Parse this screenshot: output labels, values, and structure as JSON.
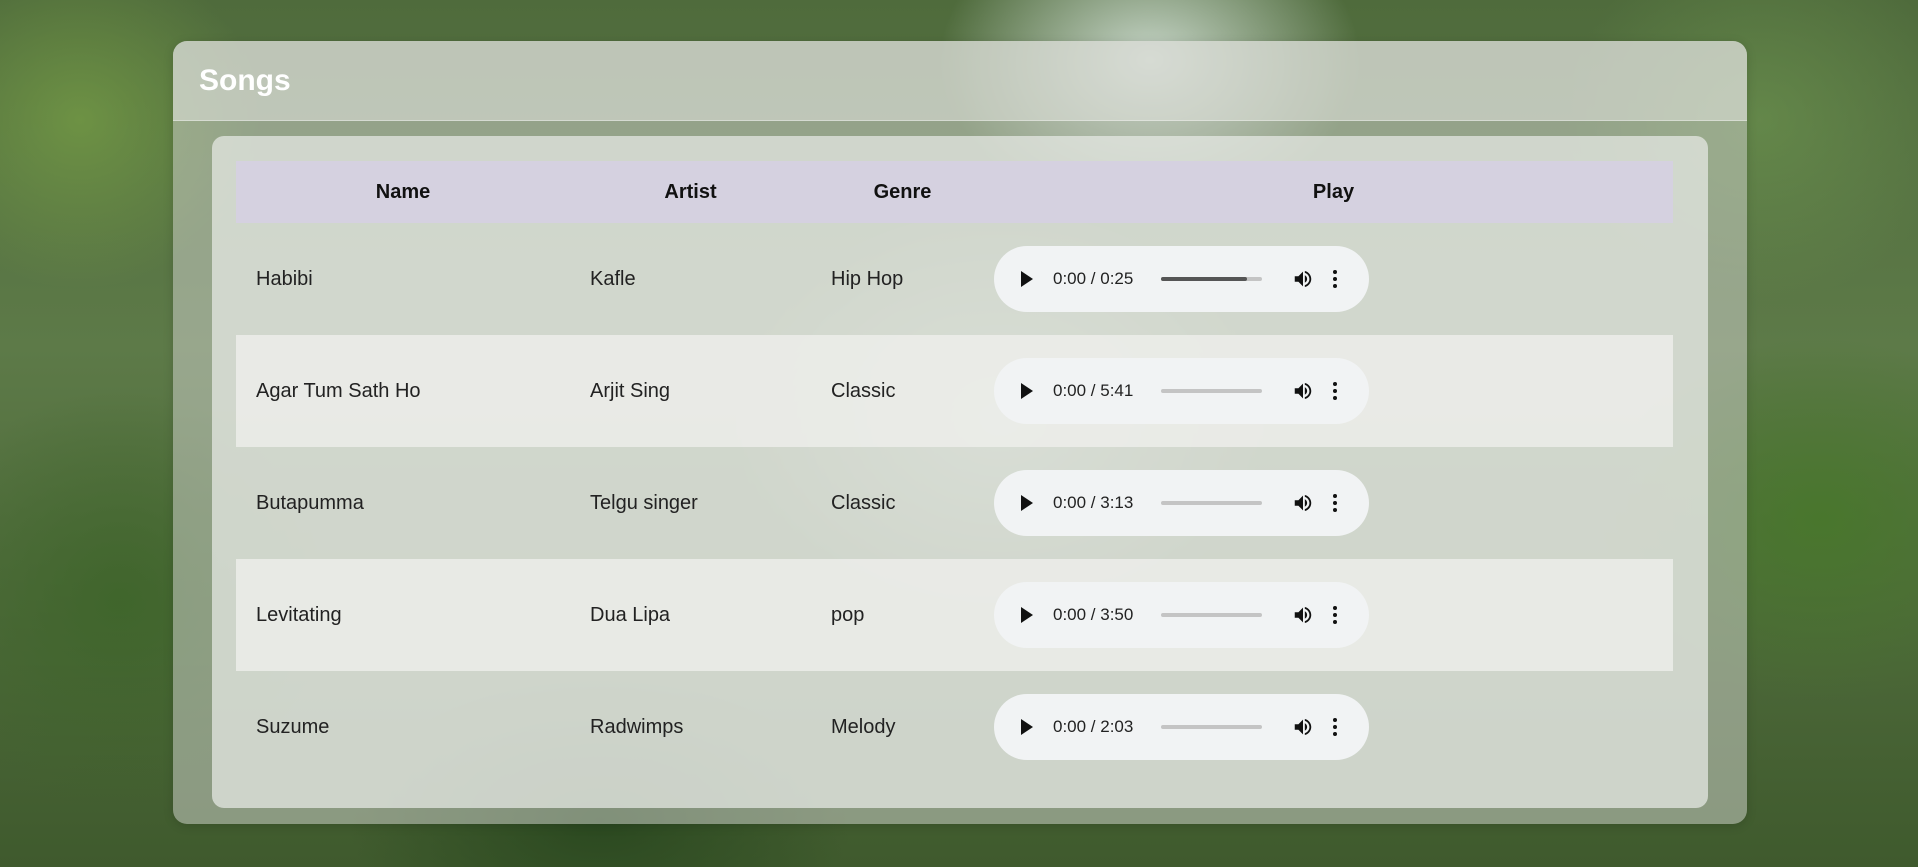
{
  "page": {
    "title": "Songs"
  },
  "table": {
    "headers": {
      "name": "Name",
      "artist": "Artist",
      "genre": "Genre",
      "play": "Play"
    },
    "rows": [
      {
        "name": "Habibi",
        "artist": "Kafle",
        "genre": "Hip Hop",
        "player": {
          "time": "0:00 / 0:25",
          "progress": 0.85
        }
      },
      {
        "name": "Agar Tum Sath Ho",
        "artist": "Arjit Sing",
        "genre": "Classic",
        "player": {
          "time": "0:00 / 5:41",
          "progress": 0.0
        }
      },
      {
        "name": "Butapumma",
        "artist": "Telgu singer",
        "genre": "Classic",
        "player": {
          "time": "0:00 / 3:13",
          "progress": 0.0
        }
      },
      {
        "name": "Levitating",
        "artist": "Dua Lipa",
        "genre": "pop",
        "player": {
          "time": "0:00 / 3:50",
          "progress": 0.0
        }
      },
      {
        "name": "Suzume",
        "artist": "Radwimps",
        "genre": "Melody",
        "player": {
          "time": "0:00 / 2:03",
          "progress": 0.0
        }
      }
    ]
  },
  "icons": {
    "play": "play-icon",
    "volume": "volume-icon",
    "menu": "more-vert-icon"
  }
}
